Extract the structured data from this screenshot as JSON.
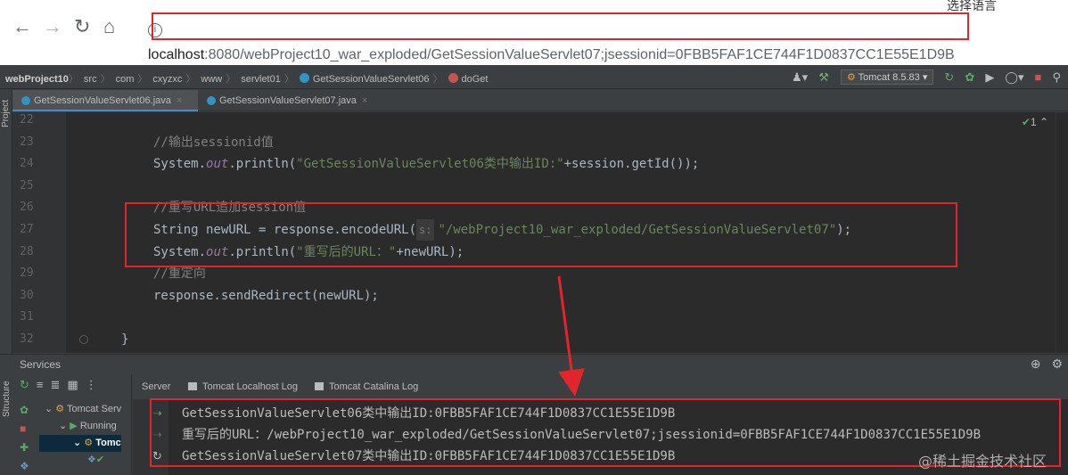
{
  "browser": {
    "url_host": "localhost",
    "url_rest": ":8080/webProject10_war_exploded/GetSessionValueServlet07;jsessionid=0FBB5FAF1CE744F1D0837CC1E55E1D9B",
    "language_label": "选择语言"
  },
  "ide": {
    "breadcrumbs": [
      "webProject10",
      "src",
      "com",
      "cxyzxc",
      "www",
      "servlet01",
      "GetSessionValueServlet06",
      "doGet"
    ],
    "run_config": "Tomcat 8.5.83",
    "tabs": [
      {
        "label": "GetSessionValueServlet06.java",
        "active": true
      },
      {
        "label": "GetSessionValueServlet07.java",
        "active": false
      }
    ],
    "left_strip_label": "Project",
    "editor_status": "1",
    "code_lines": [
      {
        "num": "22",
        "parts": [
          {
            "t": "",
            "c": "plain"
          }
        ]
      },
      {
        "num": "23",
        "parts": [
          {
            "t": "//输出sessionid值",
            "c": "cmt"
          }
        ]
      },
      {
        "num": "24",
        "parts": [
          {
            "t": "System.",
            "c": "plain"
          },
          {
            "t": "out",
            "c": "fld"
          },
          {
            "t": ".println(",
            "c": "plain"
          },
          {
            "t": "\"GetSessionValueServlet06类中输出ID:\"",
            "c": "str"
          },
          {
            "t": "+session.getId());",
            "c": "plain"
          }
        ]
      },
      {
        "num": "25",
        "parts": [
          {
            "t": "",
            "c": "plain"
          }
        ]
      },
      {
        "num": "26",
        "parts": [
          {
            "t": "//重写URL追加session值",
            "c": "cmt"
          }
        ]
      },
      {
        "num": "27",
        "parts": [
          {
            "t": "String newURL = response.encodeURL(",
            "c": "plain"
          },
          {
            "t": "s:",
            "c": "hint"
          },
          {
            "t": "\"/webProject10_war_exploded/GetSessionValueServlet07\"",
            "c": "str"
          },
          {
            "t": ");",
            "c": "plain"
          }
        ]
      },
      {
        "num": "28",
        "parts": [
          {
            "t": "System.",
            "c": "plain"
          },
          {
            "t": "out",
            "c": "fld"
          },
          {
            "t": ".println(",
            "c": "plain"
          },
          {
            "t": "\"重写后的URL：\"",
            "c": "str"
          },
          {
            "t": "+newURL);",
            "c": "plain"
          }
        ]
      },
      {
        "num": "29",
        "parts": [
          {
            "t": "//重定向",
            "c": "cmt"
          }
        ]
      },
      {
        "num": "30",
        "parts": [
          {
            "t": "response.sendRedirect(newURL);",
            "c": "plain"
          }
        ]
      },
      {
        "num": "31",
        "parts": [
          {
            "t": "",
            "c": "plain"
          }
        ]
      },
      {
        "num": "32",
        "parts": [
          {
            "t": "}",
            "c": "plain"
          }
        ]
      }
    ],
    "services": {
      "title": "Services",
      "tree": [
        "Tomcat Serv",
        "Running",
        "Tomc"
      ],
      "console_tabs": [
        "Server",
        "Tomcat Localhost Log",
        "Tomcat Catalina Log"
      ],
      "console_lines": [
        "GetSessionValueServlet06类中输出ID:0FBB5FAF1CE744F1D0837CC1E55E1D9B",
        "重写后的URL：/webProject10_war_exploded/GetSessionValueServlet07;jsessionid=0FBB5FAF1CE744F1D0837CC1E55E1D9B",
        "GetSessionValueServlet07类中输出ID:0FBB5FAF1CE744F1D0837CC1E55E1D9B"
      ],
      "left_strip_label": "Structure"
    }
  },
  "watermark": "@稀土掘金技术社区",
  "colors": {
    "highlight_box": "#e0262b",
    "editor_bg": "#2b2b2b",
    "panel_bg": "#3c3f41"
  }
}
